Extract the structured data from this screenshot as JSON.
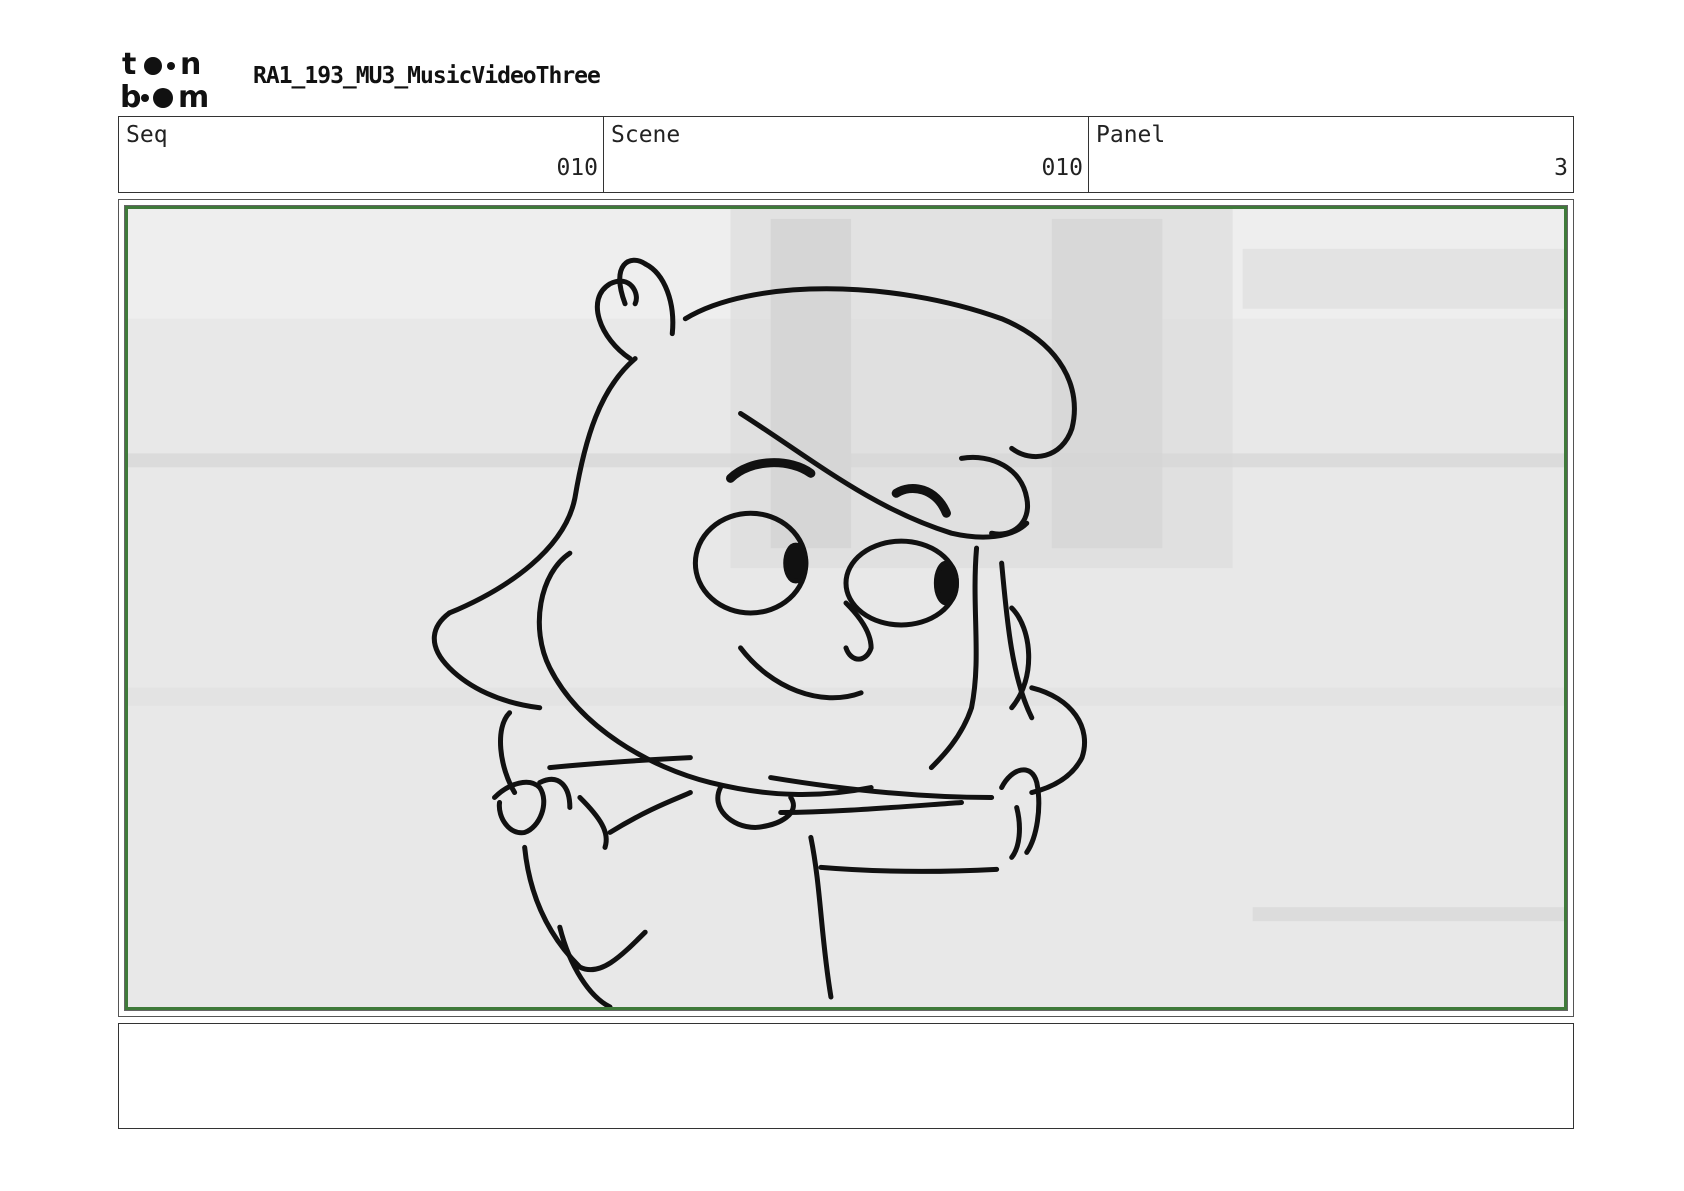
{
  "header": {
    "logo_text": "toon boom",
    "project_title": "RA1_193_MU3_MusicVideoThree"
  },
  "info": {
    "seq_label": "Seq",
    "seq_value": "010",
    "scene_label": "Scene",
    "scene_value": "010",
    "panel_label": "Panel",
    "panel_value": "3"
  },
  "panel": {
    "image_description_name": "storyboard-drawing",
    "frame_color": "#3f7a3a"
  },
  "notes": {
    "text": ""
  }
}
